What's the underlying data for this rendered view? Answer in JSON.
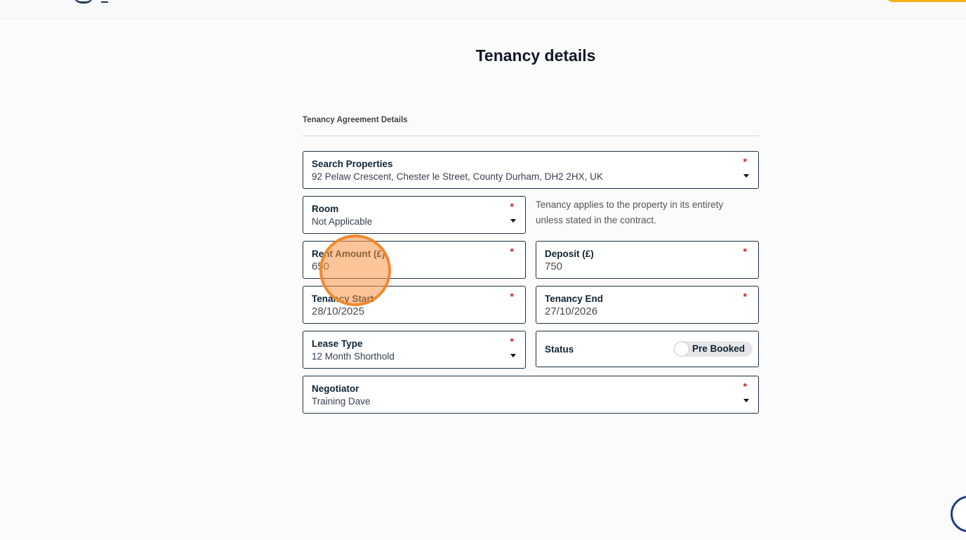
{
  "header": {
    "page_title": "Tenancy details"
  },
  "section": {
    "title": "Tenancy Agreement Details"
  },
  "fields": {
    "property": {
      "label": "Search Properties",
      "value": "92 Pelaw Crescent, Chester le Street, County Durham, DH2 2HX, UK",
      "required": "*"
    },
    "room": {
      "label": "Room",
      "value": "Not Applicable",
      "required": "*"
    },
    "room_help": "Tenancy applies to the property in its entirety unless stated in the contract.",
    "rent": {
      "label": "Rent Amount (£)",
      "value": "650",
      "required": "*"
    },
    "deposit": {
      "label": "Deposit (£)",
      "value": "750",
      "required": "*"
    },
    "start": {
      "label": "Tenancy Start",
      "value": "28/10/2025",
      "required": "*"
    },
    "end": {
      "label": "Tenancy End",
      "value": "27/10/2026",
      "required": "*"
    },
    "lease_type": {
      "label": "Lease Type",
      "value": "12 Month Shorthold",
      "required": "*"
    },
    "status": {
      "label": "Status",
      "toggle_label": "Pre Booked",
      "toggle_on": false
    },
    "negotiator": {
      "label": "Negotiator",
      "value": "Training Dave",
      "required": "*"
    }
  },
  "colors": {
    "border": "#1c3142",
    "required": "#d02020",
    "accent": "#f5b21a",
    "click_highlight": "#f0892e"
  },
  "icons": [
    "chevron-down-icon",
    "chat-icon"
  ]
}
